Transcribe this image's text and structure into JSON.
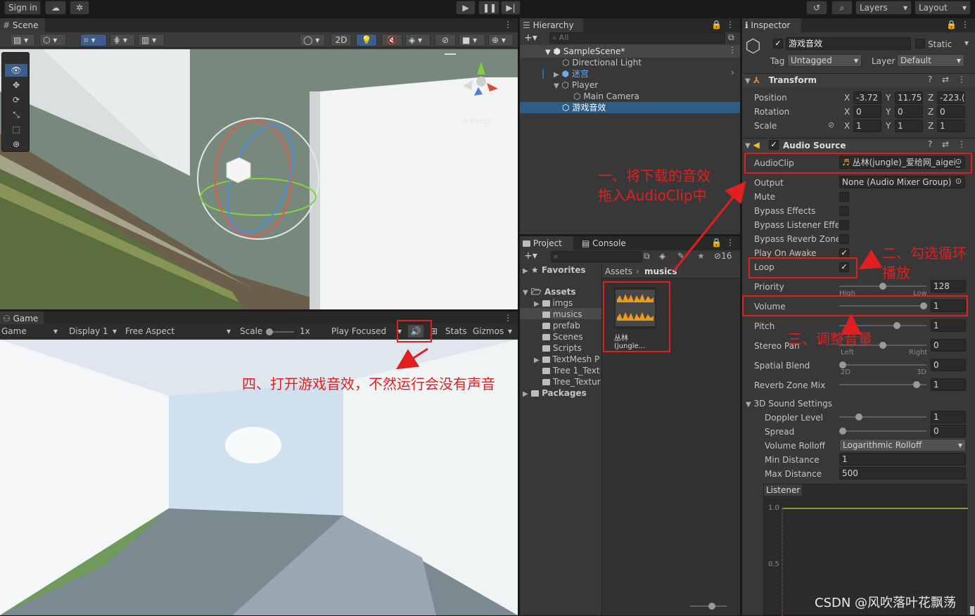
{
  "topbar": {
    "sign_in": "Sign in",
    "layers": "Layers",
    "layout": "Layout"
  },
  "scene": {
    "tab": "Scene",
    "btn_2d": "2D",
    "persp": "< Persp"
  },
  "game": {
    "tab": "Game",
    "mode": "Game",
    "display": "Display 1",
    "aspect": "Free Aspect",
    "scale_label": "Scale",
    "scale_value": "1x",
    "play_focused": "Play Focused",
    "stats": "Stats",
    "gizmos": "Gizmos"
  },
  "hierarchy": {
    "tab": "Hierarchy",
    "search_placeholder": "All",
    "items": [
      {
        "label": "SampleScene*"
      },
      {
        "label": "Directional Light"
      },
      {
        "label": "迷宫"
      },
      {
        "label": "Player"
      },
      {
        "label": "Main Camera"
      },
      {
        "label": "游戏音效"
      }
    ]
  },
  "project": {
    "tab_project": "Project",
    "tab_console": "Console",
    "hidden_count": "16",
    "favorites": "Favorites",
    "assets": "Assets",
    "folders": [
      "imgs",
      "musics",
      "prefab",
      "Scenes",
      "Scripts",
      "TextMesh P",
      "Tree 1_Text",
      "Tree_Textur"
    ],
    "packages": "Packages",
    "breadcrumb": [
      "Assets",
      "musics"
    ],
    "file_label": "丛林(jungle..."
  },
  "inspector": {
    "tab": "Inspector",
    "object_name": "游戏音效",
    "static_label": "Static",
    "tag_label": "Tag",
    "tag_value": "Untagged",
    "layer_label": "Layer",
    "layer_value": "Default",
    "transform": {
      "title": "Transform",
      "position": {
        "label": "Position",
        "x": "-3.72",
        "y": "11.75",
        "z": "-223.("
      },
      "rotation": {
        "label": "Rotation",
        "x": "0",
        "y": "0",
        "z": "0"
      },
      "scale": {
        "label": "Scale",
        "x": "1",
        "y": "1",
        "z": "1"
      }
    },
    "audio_source": {
      "title": "Audio Source",
      "audioclip_label": "AudioClip",
      "audioclip_value": "丛林(jungle)_爱给网_aigei_",
      "output_label": "Output",
      "output_value": "None (Audio Mixer Group)",
      "mute": "Mute",
      "bypass_effects": "Bypass Effects",
      "bypass_listener": "Bypass Listener Effec",
      "bypass_reverb": "Bypass Reverb Zones",
      "play_on_awake": "Play On Awake",
      "loop": "Loop",
      "priority_label": "Priority",
      "priority_value": "128",
      "high": "High",
      "low": "Low",
      "volume_label": "Volume",
      "volume_value": "1",
      "pitch_label": "Pitch",
      "pitch_value": "1",
      "stereo_label": "Stereo Pan",
      "stereo_value": "0",
      "left": "Left",
      "right": "Right",
      "spatial_label": "Spatial Blend",
      "spatial_value": "0",
      "two_d": "2D",
      "three_d": "3D",
      "reverb_label": "Reverb Zone Mix",
      "reverb_value": "1",
      "sound3d": "3D Sound Settings",
      "doppler_label": "Doppler Level",
      "doppler_value": "1",
      "spread_label": "Spread",
      "spread_value": "0",
      "rolloff_label": "Volume Rolloff",
      "rolloff_value": "Logarithmic Rolloff",
      "min_label": "Min Distance",
      "min_value": "1",
      "max_label": "Max Distance",
      "max_value": "500",
      "listener": "Listener",
      "graph_1": "1.0",
      "graph_05": "0.5"
    }
  },
  "annotations": {
    "a1_line1": "一、将下载的音效",
    "a1_line2": "拖入AudioClip中",
    "a2_line1": "二、勾选循环",
    "a2_line2": "播放",
    "a3": "三、调整音量",
    "a4": "四、打开游戏音效，不然运行会没有声音"
  },
  "watermark": "CSDN @风吹落叶花飘荡",
  "colors": {
    "annotation_red": "#e02020",
    "selection_blue": "#2c5d87",
    "accent_orange": "#f0a020"
  }
}
